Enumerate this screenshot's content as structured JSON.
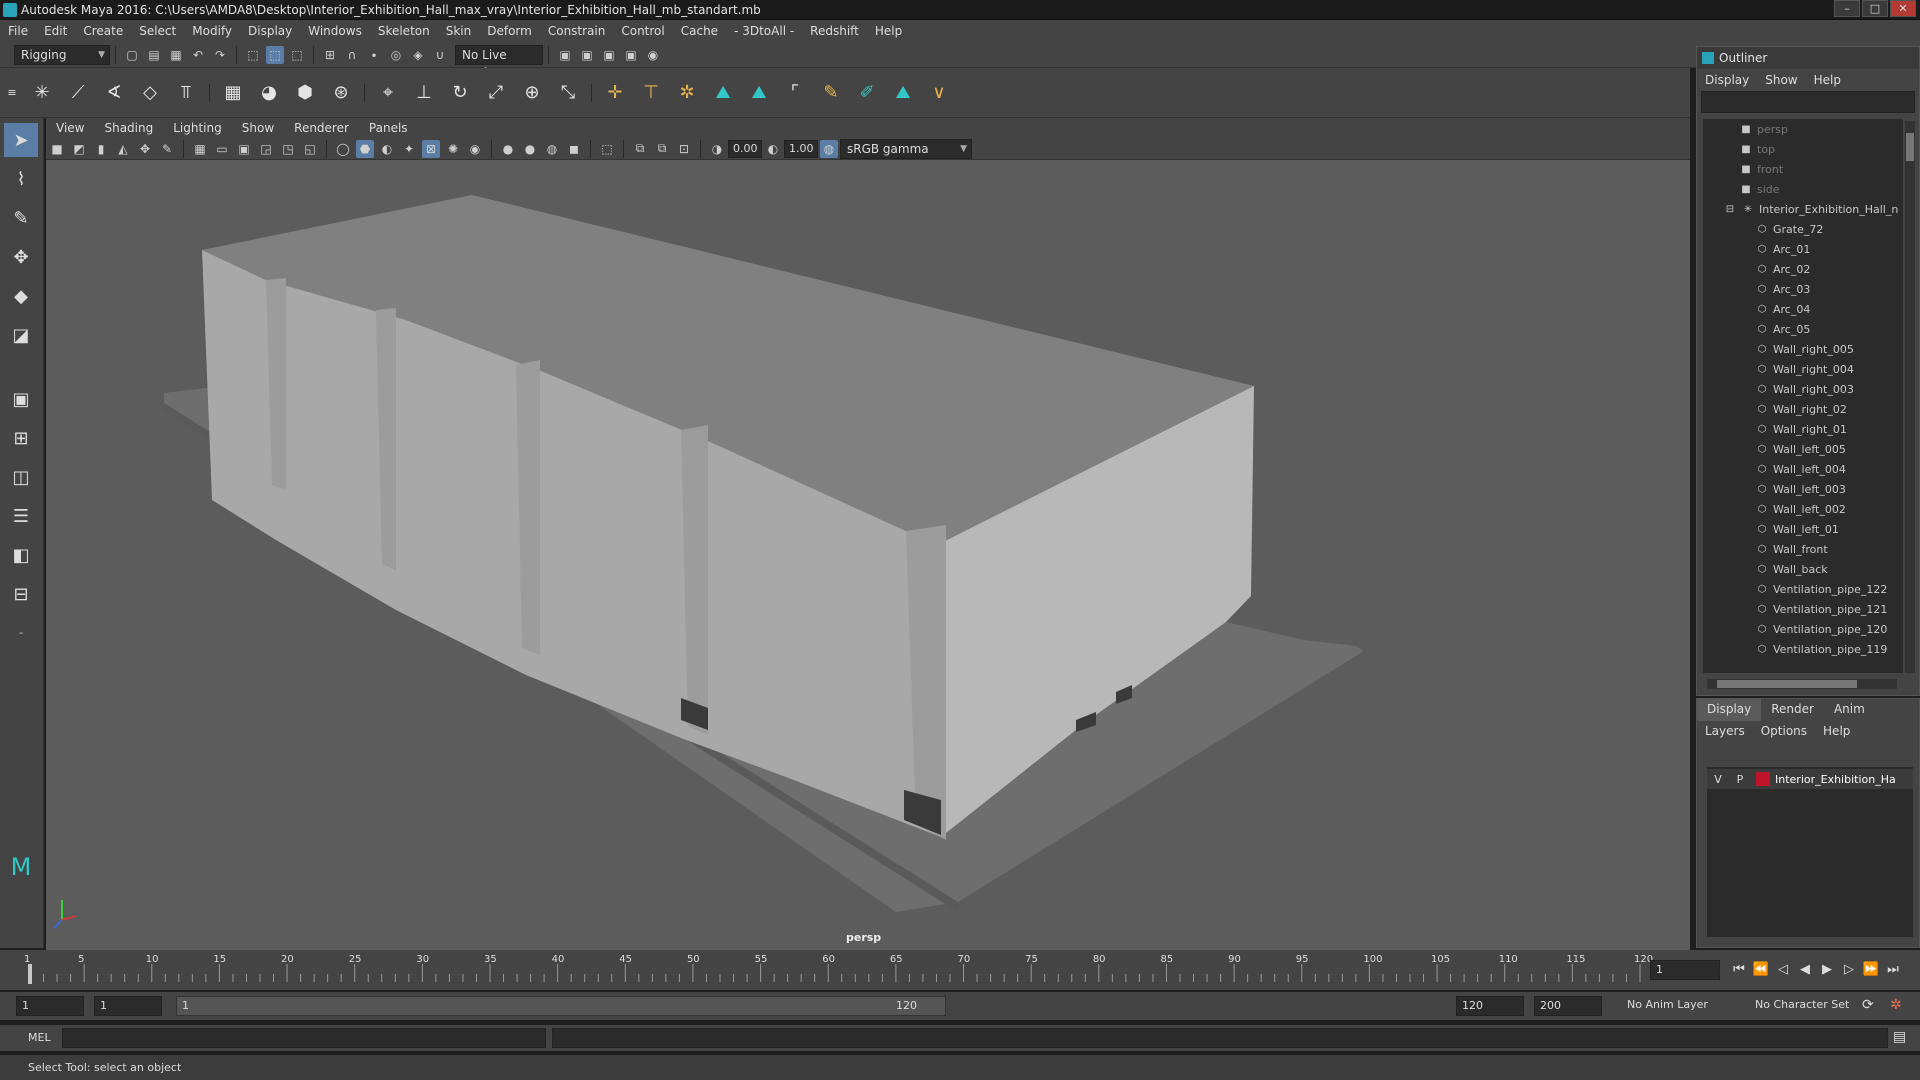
{
  "window": {
    "title": "Autodesk Maya 2016: C:\\Users\\AMDA8\\Desktop\\Interior_Exhibition_Hall_max_vray\\Interior_Exhibition_Hall_mb_standart.mb",
    "minimize": "–",
    "maximize": "□",
    "close": "✕"
  },
  "menubar": [
    "File",
    "Edit",
    "Create",
    "Select",
    "Modify",
    "Display",
    "Windows",
    "Skeleton",
    "Skin",
    "Deform",
    "Constrain",
    "Control",
    "Cache",
    "- 3DtoAll -",
    "Redshift",
    "Help"
  ],
  "statusline": {
    "menuset": "Rigging",
    "live_surface": "No Live Surface"
  },
  "panel": {
    "menu": [
      "View",
      "Shading",
      "Lighting",
      "Show",
      "Renderer",
      "Panels"
    ],
    "exposure": "0.00",
    "gamma": "1.00",
    "colorspace": "sRGB gamma",
    "camera_label": "persp"
  },
  "outliner": {
    "title": "Outliner",
    "menu": [
      "Display",
      "Show",
      "Help"
    ],
    "items": [
      {
        "label": "persp",
        "icon": "camera-icon",
        "dim": true,
        "indent": 1
      },
      {
        "label": "top",
        "icon": "camera-icon",
        "dim": true,
        "indent": 1
      },
      {
        "label": "front",
        "icon": "camera-icon",
        "dim": true,
        "indent": 1
      },
      {
        "label": "side",
        "icon": "camera-icon",
        "dim": true,
        "indent": 1
      },
      {
        "label": "Interior_Exhibition_Hall_n",
        "icon": "group-icon",
        "dim": false,
        "indent": 0
      },
      {
        "label": "Grate_72",
        "icon": "mesh-icon",
        "dim": false,
        "indent": 2
      },
      {
        "label": "Arc_01",
        "icon": "mesh-icon",
        "dim": false,
        "indent": 2
      },
      {
        "label": "Arc_02",
        "icon": "mesh-icon",
        "dim": false,
        "indent": 2
      },
      {
        "label": "Arc_03",
        "icon": "mesh-icon",
        "dim": false,
        "indent": 2
      },
      {
        "label": "Arc_04",
        "icon": "mesh-icon",
        "dim": false,
        "indent": 2
      },
      {
        "label": "Arc_05",
        "icon": "mesh-icon",
        "dim": false,
        "indent": 2
      },
      {
        "label": "Wall_right_005",
        "icon": "mesh-icon",
        "dim": false,
        "indent": 2
      },
      {
        "label": "Wall_right_004",
        "icon": "mesh-icon",
        "dim": false,
        "indent": 2
      },
      {
        "label": "Wall_right_003",
        "icon": "mesh-icon",
        "dim": false,
        "indent": 2
      },
      {
        "label": "Wall_right_02",
        "icon": "mesh-icon",
        "dim": false,
        "indent": 2
      },
      {
        "label": "Wall_right_01",
        "icon": "mesh-icon",
        "dim": false,
        "indent": 2
      },
      {
        "label": "Wall_left_005",
        "icon": "mesh-icon",
        "dim": false,
        "indent": 2
      },
      {
        "label": "Wall_left_004",
        "icon": "mesh-icon",
        "dim": false,
        "indent": 2
      },
      {
        "label": "Wall_left_003",
        "icon": "mesh-icon",
        "dim": false,
        "indent": 2
      },
      {
        "label": "Wall_left_002",
        "icon": "mesh-icon",
        "dim": false,
        "indent": 2
      },
      {
        "label": "Wall_left_01",
        "icon": "mesh-icon",
        "dim": false,
        "indent": 2
      },
      {
        "label": "Wall_front",
        "icon": "mesh-icon",
        "dim": false,
        "indent": 2
      },
      {
        "label": "Wall_back",
        "icon": "mesh-icon",
        "dim": false,
        "indent": 2
      },
      {
        "label": "Ventilation_pipe_122",
        "icon": "mesh-icon",
        "dim": false,
        "indent": 2
      },
      {
        "label": "Ventilation_pipe_121",
        "icon": "mesh-icon",
        "dim": false,
        "indent": 2
      },
      {
        "label": "Ventilation_pipe_120",
        "icon": "mesh-icon",
        "dim": false,
        "indent": 2
      },
      {
        "label": "Ventilation_pipe_119",
        "icon": "mesh-icon",
        "dim": false,
        "indent": 2
      }
    ]
  },
  "layers": {
    "tabs": [
      "Display",
      "Render",
      "Anim"
    ],
    "menu": [
      "Layers",
      "Options",
      "Help"
    ],
    "layer": {
      "v": "V",
      "p": "P",
      "name": "Interior_Exhibition_Ha",
      "color": "#c0142a"
    }
  },
  "timeline": {
    "ticks": [
      "1",
      "5",
      "10",
      "15",
      "20",
      "25",
      "30",
      "35",
      "40",
      "45",
      "50",
      "55",
      "60",
      "65",
      "70",
      "75",
      "80",
      "85",
      "90",
      "95",
      "100",
      "105",
      "110",
      "115",
      "120"
    ],
    "current_frame": "1"
  },
  "range": {
    "start": "1",
    "anim_start": "1",
    "slider_start": "1",
    "slider_end": "120",
    "anim_end": "120",
    "end": "200",
    "anim_layer": "No Anim Layer",
    "character_set": "No Character Set"
  },
  "mel": {
    "label": "MEL"
  },
  "help": {
    "text": "Select Tool: select an object"
  }
}
